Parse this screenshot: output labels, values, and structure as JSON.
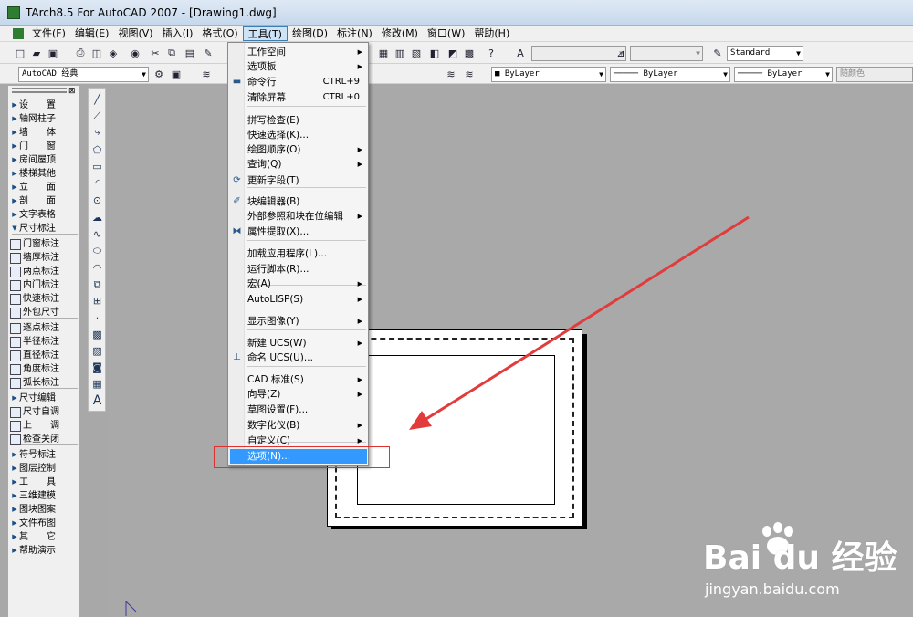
{
  "window": {
    "title": "TArch8.5 For AutoCAD 2007 - [Drawing1.dwg]"
  },
  "menubar": {
    "items": [
      "文件(F)",
      "编辑(E)",
      "视图(V)",
      "插入(I)",
      "格式(O)",
      "工具(T)",
      "绘图(D)",
      "标注(N)",
      "修改(M)",
      "窗口(W)",
      "帮助(H)"
    ]
  },
  "toolbar": {
    "workspace": "AutoCAD 经典",
    "text_style": "Standard",
    "color": "ByLayer",
    "linetype": "ByLayer",
    "lineweight": "ByLayer",
    "plot_style": "随颜色"
  },
  "tools_menu": {
    "items": [
      {
        "label": "工作空间",
        "submenu": true
      },
      {
        "label": "选项板",
        "submenu": true
      },
      {
        "label": "命令行",
        "shortcut": "CTRL+9",
        "icon": "command-line-icon"
      },
      {
        "label": "清除屏幕",
        "shortcut": "CTRL+0"
      },
      {
        "label": "拼写检查(E)"
      },
      {
        "label": "快速选择(K)..."
      },
      {
        "label": "绘图顺序(O)",
        "submenu": true
      },
      {
        "label": "查询(Q)",
        "submenu": true
      },
      {
        "label": "更新字段(T)",
        "icon": "update-field-icon"
      },
      {
        "label": "块编辑器(B)",
        "icon": "block-editor-icon"
      },
      {
        "label": "外部参照和块在位编辑",
        "submenu": true
      },
      {
        "label": "属性提取(X)...",
        "icon": "attribute-extract-icon"
      },
      {
        "label": "加载应用程序(L)..."
      },
      {
        "label": "运行脚本(R)..."
      },
      {
        "label": "宏(A)",
        "submenu": true
      },
      {
        "label": "AutoLISP(S)",
        "submenu": true
      },
      {
        "label": "显示图像(Y)",
        "submenu": true
      },
      {
        "label": "新建 UCS(W)",
        "submenu": true
      },
      {
        "label": "命名 UCS(U)...",
        "icon": "named-ucs-icon"
      },
      {
        "label": "CAD 标准(S)",
        "submenu": true
      },
      {
        "label": "向导(Z)",
        "submenu": true
      },
      {
        "label": "草图设置(F)..."
      },
      {
        "label": "数字化仪(B)",
        "submenu": true
      },
      {
        "label": "自定义(C)",
        "submenu": true
      },
      {
        "label": "选项(N)..."
      }
    ]
  },
  "tarch_panel": {
    "items": [
      "设　　置",
      "轴网柱子",
      "墙　　体",
      "门　　窗",
      "房间屋顶",
      "楼梯其他",
      "立　　面",
      "剖　　面",
      "文字表格",
      "尺寸标注",
      "门窗标注",
      "墙厚标注",
      "两点标注",
      "内门标注",
      "快速标注",
      "外包尺寸",
      "逐点标注",
      "半径标注",
      "直径标注",
      "角度标注",
      "弧长标注",
      "尺寸编辑",
      "尺寸自调",
      "上　　调",
      "检查关闭",
      "符号标注",
      "图层控制",
      "工　　具",
      "三维建模",
      "图块图案",
      "文件布图",
      "其　　它",
      "帮助演示"
    ]
  },
  "watermark": {
    "brand": "Bai du 经验",
    "url": "jingyan.baidu.com"
  }
}
